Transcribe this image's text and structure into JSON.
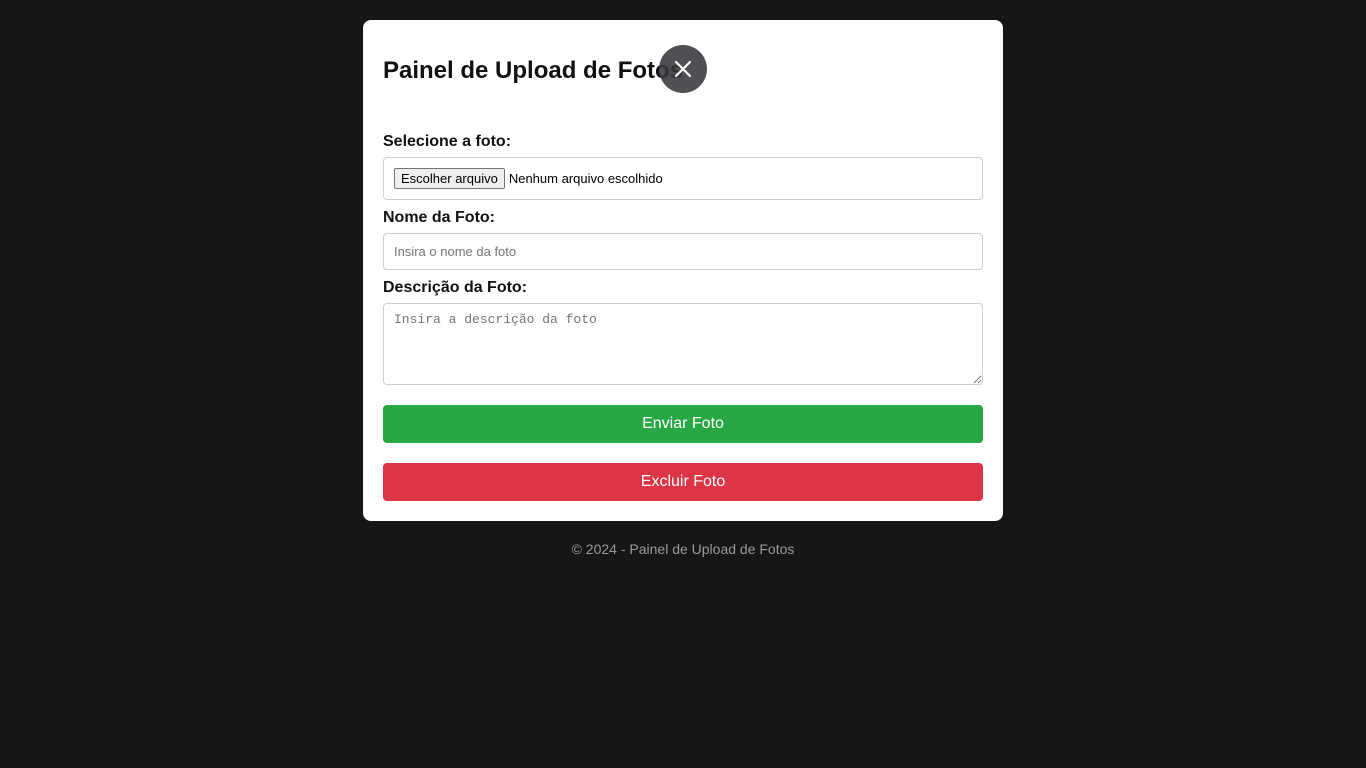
{
  "panel": {
    "title": "Painel de Upload de Fotos",
    "close_icon": "close-icon"
  },
  "form": {
    "file_label": "Selecione a foto:",
    "file_button_label": "Escolher arquivo",
    "file_status": "Nenhum arquivo escolhido",
    "name_label": "Nome da Foto:",
    "name_value": "",
    "name_placeholder": "Insira o nome da foto",
    "description_label": "Descrição da Foto:",
    "description_value": "",
    "description_placeholder": "Insira a descrição da foto",
    "send_button": "Enviar Foto",
    "delete_button": "Excluir Foto"
  },
  "colors": {
    "background": "#161616",
    "panel": "#ffffff",
    "send": "#28a745",
    "delete": "#dc3545",
    "footer_text": "#9a9a9a"
  },
  "footer": {
    "text": "© 2024 - Painel de Upload de Fotos"
  }
}
